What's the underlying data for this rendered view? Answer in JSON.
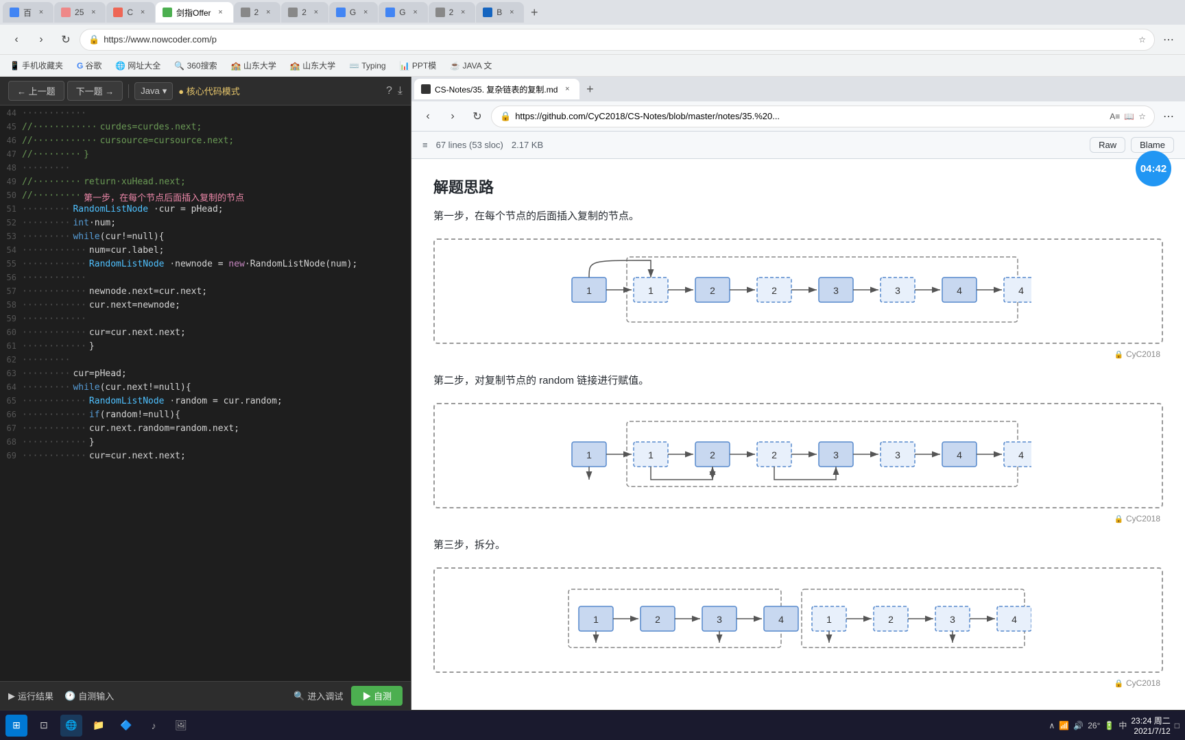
{
  "browser1": {
    "tabs": [
      {
        "label": "百",
        "active": false,
        "color": "#4285f4"
      },
      {
        "label": "25",
        "active": false
      },
      {
        "label": "C",
        "active": false
      },
      {
        "label": "剑指Offer",
        "active": true
      },
      {
        "label": "2",
        "active": false
      },
      {
        "label": "2",
        "active": false
      },
      {
        "label": "G",
        "active": false
      },
      {
        "label": "G",
        "active": false
      },
      {
        "label": "2",
        "active": false
      },
      {
        "label": "B",
        "active": false
      }
    ],
    "url": "https://www.nowcoder.com/p",
    "bookmarks": [
      "手机收藏夹",
      "谷歌",
      "网址大全",
      "360搜索",
      "山东大学",
      "山东大学",
      "Typing",
      "PPT模",
      "JAVA 文"
    ]
  },
  "left_pane": {
    "prev_btn": "← 上一题",
    "next_btn": "下一题 →",
    "lang": "Java",
    "mode": "● 核心代码模式",
    "lines": [
      {
        "num": "44",
        "dots": "·············",
        "content": ""
      },
      {
        "num": "45",
        "dots": "//············",
        "content": "curdes=curdes.next;"
      },
      {
        "num": "46",
        "dots": "//············",
        "content": "cursource=cursource.next;"
      },
      {
        "num": "47",
        "dots": "//·········",
        "content": "}"
      },
      {
        "num": "48",
        "dots": "·········",
        "content": ""
      },
      {
        "num": "49",
        "dots": "//·········",
        "content": "return·xuHead.next;"
      },
      {
        "num": "50",
        "dots": "//·········",
        "content": "第一步，在每个节点后面插入复制的节点",
        "highlight": true
      },
      {
        "num": "51",
        "dots": "·········",
        "content": "RandomListNode·cur = pHead;"
      },
      {
        "num": "52",
        "dots": "·········",
        "content": "int·num;"
      },
      {
        "num": "53",
        "dots": "·········",
        "content": "while(cur!=null){"
      },
      {
        "num": "54",
        "dots": "············",
        "content": "num=cur.label;"
      },
      {
        "num": "55",
        "dots": "············",
        "content": "RandomListNode·newnode = new·RandomListNode(num);"
      },
      {
        "num": "56",
        "dots": "············",
        "content": ""
      },
      {
        "num": "57",
        "dots": "············",
        "content": "newnode.next=cur.next;"
      },
      {
        "num": "58",
        "dots": "············",
        "content": "cur.next=newnode;"
      },
      {
        "num": "59",
        "dots": "············",
        "content": ""
      },
      {
        "num": "60",
        "dots": "············",
        "content": "cur=cur.next.next;"
      },
      {
        "num": "61",
        "dots": "············",
        "content": "}"
      },
      {
        "num": "62",
        "dots": "·········",
        "content": ""
      },
      {
        "num": "63",
        "dots": "·········",
        "content": "cur=pHead;"
      },
      {
        "num": "64",
        "dots": "·········",
        "content": "while(cur.next!=null){"
      },
      {
        "num": "65",
        "dots": "············",
        "content": "RandomListNode·random = cur.random;"
      },
      {
        "num": "66",
        "dots": "············",
        "content": "if(random!=null){"
      },
      {
        "num": "67",
        "dots": "············",
        "content": "cur.next.random=random.next;"
      },
      {
        "num": "68",
        "dots": "············",
        "content": "}"
      },
      {
        "num": "69",
        "dots": "············",
        "content": "cur=cur.next.next;"
      }
    ],
    "bottom": {
      "run_result": "运行结果",
      "self_input": "自测输入",
      "debug": "进入调试",
      "self_test": "▶ 自测"
    }
  },
  "browser2": {
    "tab_label": "CS-Notes/35. 复杂链表的复制.md",
    "url": "https://github.com/CyC2018/CS-Notes/blob/master/notes/35.%20...",
    "file_meta": {
      "lines": "67 lines (53 sloc)",
      "size": "2.17 KB"
    },
    "actions": {
      "raw": "Raw",
      "blame": "Blame"
    }
  },
  "content": {
    "title": "解题思路",
    "step1_text": "第一步，在每个节点的后面插入复制的节点。",
    "step2_text": "第二步，对复制节点的 random 链接进行赋值。",
    "step3_text": "第三步，拆分。",
    "caption": "CyC2018",
    "diagram1": {
      "nodes_original": [
        1,
        2,
        3,
        4
      ],
      "nodes_copy": [
        1,
        2,
        3,
        4
      ],
      "interleaved": [
        1,
        1,
        2,
        2,
        3,
        3,
        4,
        4
      ]
    },
    "timer": "04:42"
  },
  "taskbar": {
    "time": "23:24 周二",
    "date": "2021/7/12",
    "temp": "26°",
    "battery": "100%",
    "icons": [
      "start",
      "task-view",
      "browser",
      "files",
      "edge",
      "music",
      "photos",
      "store"
    ]
  }
}
